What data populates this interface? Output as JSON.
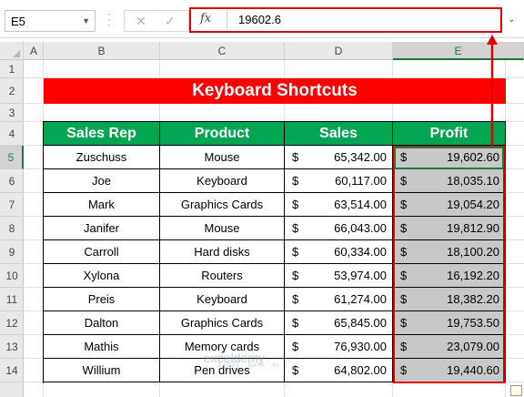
{
  "formula_bar": {
    "name_box": "E5",
    "cancel_glyph": "✕",
    "enter_glyph": "✓",
    "fx_label": "fx",
    "value": "19602.6"
  },
  "columns": [
    "A",
    "B",
    "C",
    "D",
    "E"
  ],
  "selected_column": "E",
  "rows": [
    "1",
    "2",
    "3",
    "4",
    "5",
    "6",
    "7",
    "8",
    "9",
    "10",
    "11",
    "12",
    "13",
    "14"
  ],
  "selected_row": "5",
  "title": "Keyboard Shortcuts",
  "table": {
    "headers": [
      "Sales Rep",
      "Product",
      "Sales",
      "Profit"
    ],
    "currency": "$",
    "rows": [
      {
        "rep": "Zuschuss",
        "product": "Mouse",
        "sales": "65,342.00",
        "profit": "19,602.60"
      },
      {
        "rep": "Joe",
        "product": "Keyboard",
        "sales": "60,117.00",
        "profit": "18,035.10"
      },
      {
        "rep": "Mark",
        "product": "Graphics Cards",
        "sales": "63,514.00",
        "profit": "19,054.20"
      },
      {
        "rep": "Janifer",
        "product": "Mouse",
        "sales": "66,043.00",
        "profit": "19,812.90"
      },
      {
        "rep": "Carroll",
        "product": "Hard disks",
        "sales": "60,334.00",
        "profit": "18,100.20"
      },
      {
        "rep": "Xylona",
        "product": "Routers",
        "sales": "53,974.00",
        "profit": "16,192.20"
      },
      {
        "rep": "Preis",
        "product": "Keyboard",
        "sales": "61,274.00",
        "profit": "18,382.20"
      },
      {
        "rep": "Dalton",
        "product": "Graphics Cards",
        "sales": "65,845.00",
        "profit": "19,753.50"
      },
      {
        "rep": "Mathis",
        "product": "Memory cards",
        "sales": "76,930.00",
        "profit": "23,079.00"
      },
      {
        "rep": "Willium",
        "product": "Pen drives",
        "sales": "64,802.00",
        "profit": "19,440.60"
      }
    ]
  },
  "watermark": {
    "name": "exceldemy",
    "tagline": "EXCEL · DATA · BI"
  },
  "colors": {
    "title_bg": "#ff0000",
    "header_bg": "#00a651",
    "highlight": "#e00000",
    "profit_bg": "#c8c8c8",
    "selection": "#107c41"
  }
}
